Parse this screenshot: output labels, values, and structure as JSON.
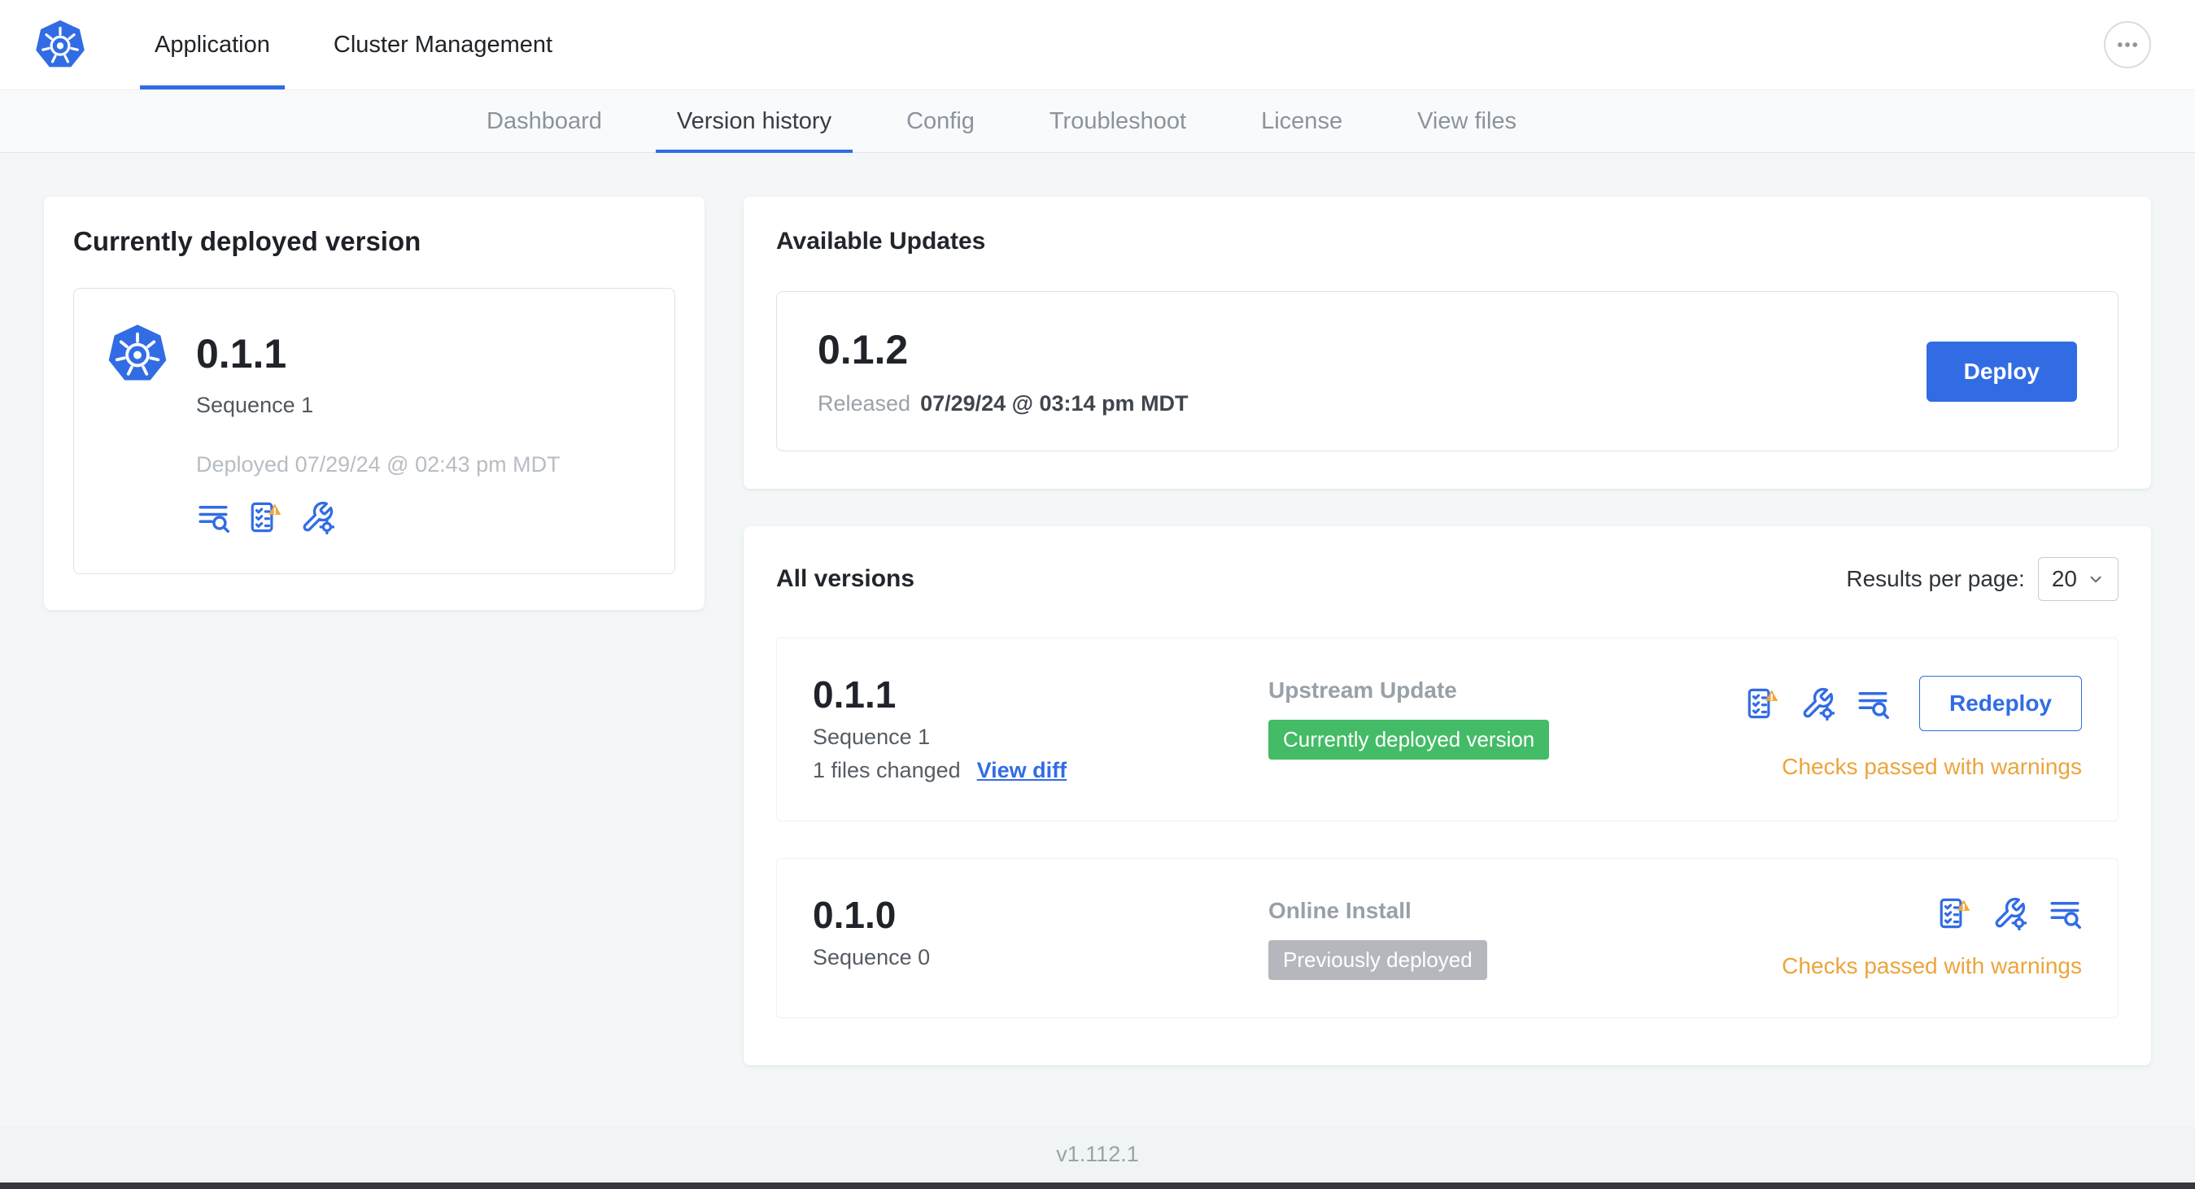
{
  "header": {
    "tabs": [
      {
        "label": "Application"
      },
      {
        "label": "Cluster Management"
      }
    ]
  },
  "subnav": {
    "tabs": [
      "Dashboard",
      "Version history",
      "Config",
      "Troubleshoot",
      "License",
      "View files"
    ],
    "active_tab": "Version history"
  },
  "currently_deployed": {
    "title": "Currently deployed version",
    "version": "0.1.1",
    "sequence": "Sequence 1",
    "deployed_at": "Deployed 07/29/24 @ 02:43 pm MDT"
  },
  "available_updates": {
    "title": "Available Updates",
    "version": "0.1.2",
    "released_prefix": "Released",
    "released_date": "07/29/24 @ 03:14 pm MDT",
    "deploy_label": "Deploy"
  },
  "all_versions": {
    "title": "All versions",
    "results_per_page_label": "Results per page:",
    "results_per_page_value": "20",
    "versions": [
      {
        "version": "0.1.1",
        "sequence": "Sequence 1",
        "files_changed": "1 files changed",
        "view_diff_label": "View diff",
        "source": "Upstream Update",
        "badge": "Currently deployed version",
        "action_label": "Redeploy",
        "status": "Checks passed with warnings"
      },
      {
        "version": "0.1.0",
        "sequence": "Sequence 0",
        "source": "Online Install",
        "badge": "Previously deployed",
        "status": "Checks passed with warnings"
      }
    ]
  },
  "footer": {
    "app_version": "v1.112.1"
  },
  "icons": {
    "kubernetes-logo-icon": "blue-heptagon-helm-wheel",
    "more-options-icon": "horizontal-ellipsis",
    "release-notes-icon": "text-lines-with-magnifier",
    "preflight-checks-icon": "checklist-with-warning-triangle",
    "config-icon": "wrench-with-gear",
    "chevron-down-icon": "chevron-down"
  },
  "colors": {
    "accent": "#326ce5",
    "success_badge": "#44bb66",
    "muted_badge": "#b4b8bc",
    "warning_text": "#eca43c"
  }
}
